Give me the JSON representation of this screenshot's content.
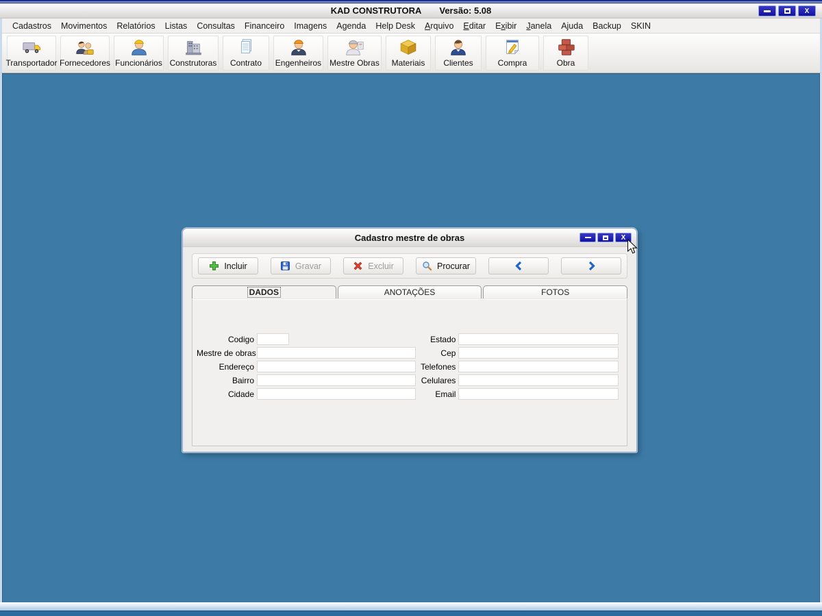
{
  "window": {
    "title": "KAD CONSTRUTORA",
    "version": "Versão: 5.08",
    "close_glyph": "X"
  },
  "menu": {
    "items": [
      {
        "label": "Cadastros",
        "accel_index": -1
      },
      {
        "label": "Movimentos",
        "accel_index": -1
      },
      {
        "label": "Relatórios",
        "accel_index": -1
      },
      {
        "label": "Listas",
        "accel_index": -1
      },
      {
        "label": "Consultas",
        "accel_index": -1
      },
      {
        "label": "Financeiro",
        "accel_index": -1
      },
      {
        "label": "Imagens",
        "accel_index": -1
      },
      {
        "label": "Agenda",
        "accel_index": -1
      },
      {
        "label": "Help Desk",
        "accel_index": -1
      },
      {
        "label": "Arquivo",
        "accel_index": 0
      },
      {
        "label": "Editar",
        "accel_index": 0
      },
      {
        "label": "Exibir",
        "accel_index": 1
      },
      {
        "label": "Janela",
        "accel_index": 0
      },
      {
        "label": "Ajuda",
        "accel_index": -1
      },
      {
        "label": "Backup",
        "accel_index": -1
      },
      {
        "label": "SKIN",
        "accel_index": -1
      }
    ]
  },
  "toolbar": {
    "buttons": [
      {
        "label": "Transportador",
        "icon": "truck-icon"
      },
      {
        "label": "Fornecedores",
        "icon": "suppliers-icon"
      },
      {
        "label": "Funcionários",
        "icon": "worker-icon"
      },
      {
        "label": "Construtoras",
        "icon": "building-icon"
      },
      {
        "label": "Contrato",
        "icon": "contract-icon"
      },
      {
        "label": "Engenheiros",
        "icon": "engineer-icon"
      },
      {
        "label": "Mestre Obras",
        "icon": "foreman-icon"
      },
      {
        "label": "Materiais",
        "icon": "materials-box-icon"
      },
      {
        "label": "Clientes",
        "icon": "client-icon"
      },
      {
        "label": "Compra",
        "icon": "purchase-icon"
      },
      {
        "label": "Obra",
        "icon": "bricks-icon"
      }
    ]
  },
  "dialog": {
    "title": "Cadastro mestre de obras",
    "close_glyph": "X",
    "commands": {
      "incluir": "Incluir",
      "gravar": "Gravar",
      "excluir": "Excluir",
      "procurar": "Procurar"
    },
    "tabs": [
      {
        "label": "DADOS",
        "active": true
      },
      {
        "label": "ANOTAÇÕES",
        "active": false
      },
      {
        "label": "FOTOS",
        "active": false
      }
    ],
    "form": {
      "left": [
        {
          "label": "Codigo",
          "value": ""
        },
        {
          "label": "Mestre de obras",
          "value": ""
        },
        {
          "label": "Endereço",
          "value": ""
        },
        {
          "label": "Bairro",
          "value": ""
        },
        {
          "label": "Cidade",
          "value": ""
        }
      ],
      "right": [
        {
          "label": "Estado",
          "value": ""
        },
        {
          "label": "Cep",
          "value": ""
        },
        {
          "label": "Telefones",
          "value": ""
        },
        {
          "label": "Celulares",
          "value": ""
        },
        {
          "label": "Email",
          "value": ""
        }
      ]
    }
  },
  "colors": {
    "desktop_blue": "#3d7ba6",
    "titlebar_button_navy": "#1212a0",
    "frame_navy": "#20308e",
    "accent_green": "#52b848",
    "accent_red": "#d43b2a",
    "accent_blue": "#1b66c9"
  }
}
